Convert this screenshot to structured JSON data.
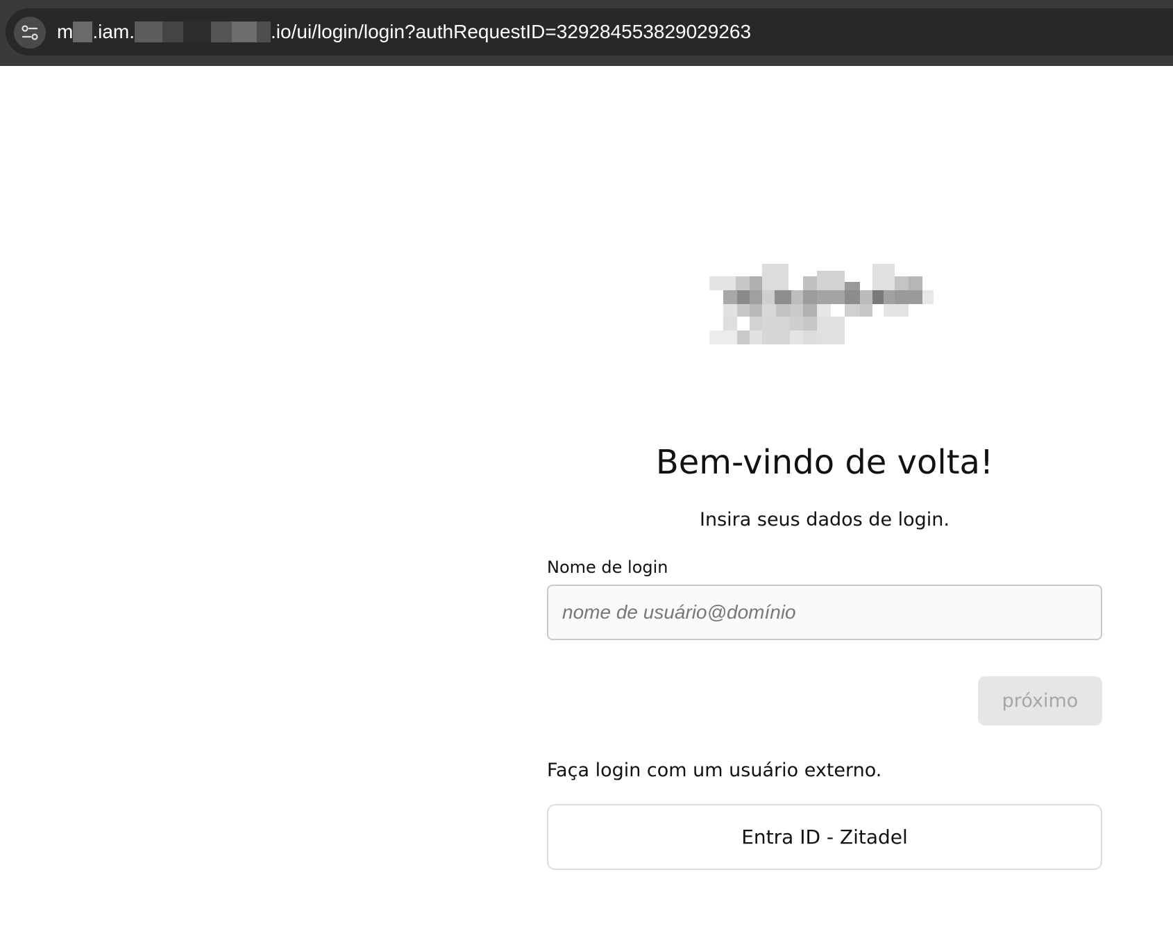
{
  "browser": {
    "url_prefix": "m",
    "url_part2": ".iam.",
    "url_suffix": ".io/ui/login/login?authRequestID=329284553829029263",
    "site_info_icon": "tune-icon"
  },
  "login": {
    "title": "Bem-vindo de volta!",
    "subtitle": "Insira seus dados de login.",
    "field_label": "Nome de login",
    "input_placeholder": "nome de usuário@domínio",
    "input_value": "",
    "next_button": "próximo",
    "external_text": "Faça login com um usuário externo.",
    "idp_button": "Entra ID - Zitadel"
  },
  "colors": {
    "accent_disabled_bg": "#e6e6e6",
    "accent_disabled_text": "#a6a6a6",
    "browser_bar": "#3a3a3a"
  }
}
